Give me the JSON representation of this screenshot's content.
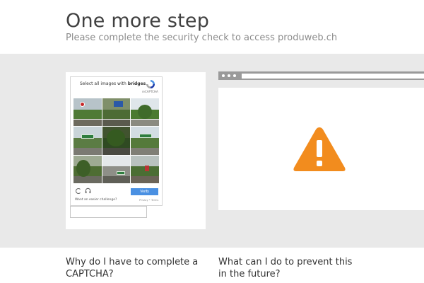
{
  "header": {
    "title": "One more step",
    "subtitle": "Please complete the security check to access produweb.ch"
  },
  "captcha": {
    "prompt_prefix": "Select all images with ",
    "prompt_target": "bridges",
    "prompt_suffix": ".",
    "recaptcha_label": "reCAPTCHA",
    "verify_label": "Verify",
    "easier_label": "Want an easier challenge?",
    "privacy_label": "Privacy • Terms",
    "reload_icon": "reload-icon",
    "audio_icon": "headphones-icon"
  },
  "answer_input": {
    "value": "",
    "placeholder": ""
  },
  "warning": {
    "icon": "warning-triangle-icon",
    "color": "#f28c1e"
  },
  "faq": {
    "q1": "Why do I have to complete a CAPTCHA?",
    "q2": "What can I do to prevent this in the future?"
  },
  "colors": {
    "band": "#e9e9e9",
    "browser_bar": "#9a9a9a",
    "verify": "#4a90e2"
  }
}
